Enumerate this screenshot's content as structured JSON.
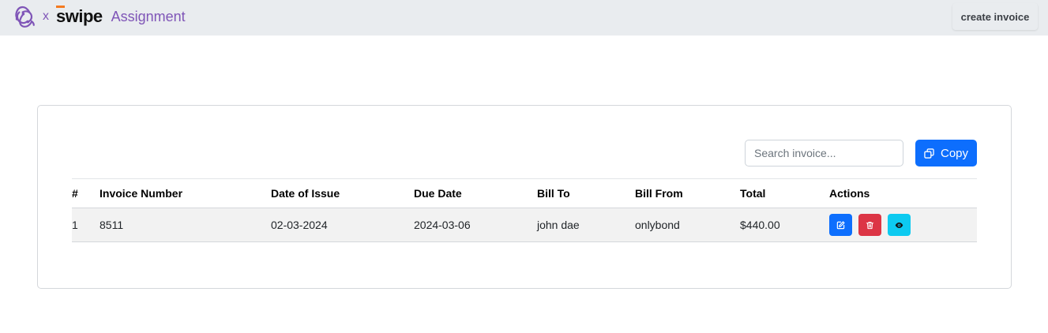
{
  "navbar": {
    "separator": "x",
    "logo_text": "swipe",
    "title": "Assignment",
    "create_button_label": "create invoice"
  },
  "toolbar": {
    "search_placeholder": "Search invoice...",
    "copy_label": "Copy"
  },
  "table": {
    "headers": [
      "#",
      "Invoice Number",
      "Date of Issue",
      "Due Date",
      "Bill To",
      "Bill From",
      "Total",
      "Actions"
    ],
    "rows": [
      {
        "index": "1",
        "invoice_number": "8511",
        "date_of_issue": "02-03-2024",
        "due_date": "2024-03-06",
        "bill_to": "john dae",
        "bill_from": "onlybond",
        "total": "$440.00"
      }
    ]
  },
  "icons": {
    "brand": "redux-icon",
    "copy": "copy-icon",
    "edit": "edit-icon",
    "delete": "trash-icon",
    "view": "eye-icon"
  },
  "colors": {
    "navbar_bg": "#e9ecef",
    "brand_purple": "#7f55b7",
    "primary": "#0d6efd",
    "danger": "#dc3545",
    "info": "#0dcaf0",
    "swipe_accent": "#f47a20"
  }
}
